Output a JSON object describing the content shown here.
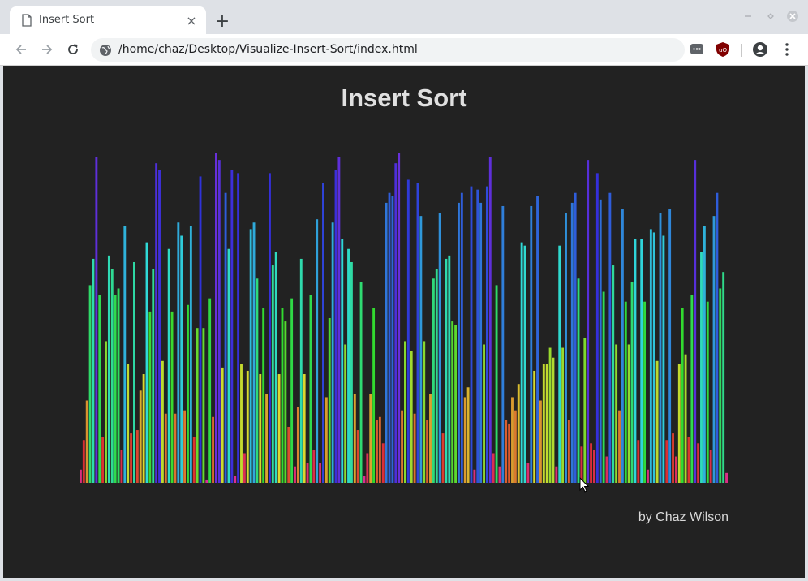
{
  "browser": {
    "tab_title": "Insert Sort",
    "tab_close": "×",
    "new_tab": "+",
    "url": "/home/chaz/Desktop/Visualize-Insert-Sort/index.html",
    "window_controls": [
      "minimize-icon",
      "maximize-icon",
      "close-icon"
    ]
  },
  "page": {
    "title": "Insert Sort",
    "byline": "by Chaz Wilson",
    "background": "#222222"
  },
  "visualization": {
    "description_colors": "hue cycles from magenta (short) through red, orange, yellow, green, teal, blue to violet (tall)",
    "bar_count": 200,
    "max_value": 1.0,
    "values": [
      0.04,
      0.13,
      0.25,
      0.6,
      0.68,
      0.99,
      0.57,
      0.14,
      0.43,
      0.69,
      0.65,
      0.57,
      0.59,
      0.1,
      0.78,
      0.36,
      0.15,
      0.67,
      0.16,
      0.28,
      0.33,
      0.73,
      0.52,
      0.65,
      0.97,
      0.95,
      0.37,
      0.21,
      0.71,
      0.52,
      0.21,
      0.79,
      0.75,
      0.22,
      0.54,
      0.78,
      0.14,
      0.47,
      0.93,
      0.47,
      0.01,
      0.56,
      0.2,
      1.0,
      0.98,
      0.35,
      0.88,
      0.71,
      0.95,
      0.02,
      0.94,
      0.36,
      0.09,
      0.34,
      0.77,
      0.79,
      0.62,
      0.33,
      0.53,
      0.27,
      0.94,
      0.66,
      0.7,
      0.33,
      0.53,
      0.49,
      0.17,
      0.56,
      0.05,
      0.23,
      0.68,
      0.33,
      0.06,
      0.57,
      0.1,
      0.8,
      0.06,
      0.91,
      0.26,
      0.5,
      0.79,
      0.95,
      0.99,
      0.74,
      0.42,
      0.71,
      0.67,
      0.27,
      0.16,
      0.61,
      0.02,
      0.09,
      0.27,
      0.53,
      0.19,
      0.2,
      0.12,
      0.85,
      0.88,
      0.87,
      0.97,
      1.0,
      0.22,
      0.43,
      0.92,
      0.4,
      0.21,
      0.91,
      0.81,
      0.43,
      0.19,
      0.27,
      0.62,
      0.65,
      0.82,
      0.15,
      0.68,
      0.69,
      0.49,
      0.48,
      0.85,
      0.88,
      0.26,
      0.29,
      0.9,
      0.04,
      0.89,
      0.85,
      0.42,
      0.9,
      0.99,
      0.09,
      0.6,
      0.05,
      0.84,
      0.19,
      0.18,
      0.26,
      0.22,
      0.3,
      0.73,
      0.72,
      0.06,
      0.84,
      0.34,
      0.87,
      0.25,
      0.36,
      0.36,
      0.41,
      0.38,
      0.05,
      0.72,
      0.41,
      0.82,
      0.19,
      0.85,
      0.88,
      0.62,
      0.11,
      0.44,
      0.98,
      0.12,
      0.1,
      0.94,
      0.86,
      0.58,
      0.08,
      0.88,
      0.66,
      0.42,
      0.22,
      0.83,
      0.55,
      0.42,
      0.61,
      0.74,
      0.13,
      0.74,
      0.55,
      0.04,
      0.77,
      0.76,
      0.37,
      0.82,
      0.75,
      0.13,
      0.83,
      0.15,
      0.08,
      0.36,
      0.53,
      0.39,
      0.14,
      0.57,
      0.98,
      0.12,
      0.7,
      0.78,
      0.55,
      0.1,
      0.81,
      0.88,
      0.59,
      0.64,
      0.03
    ]
  },
  "icons": {
    "tab": "document-icon",
    "back": "back-arrow-icon",
    "forward": "forward-arrow-icon",
    "reload": "reload-icon",
    "site_info": "globe-icon",
    "ext1": "chat-extension-icon",
    "ext2": "ublock-shield-icon",
    "profile": "profile-icon",
    "menu": "kebab-menu-icon"
  }
}
